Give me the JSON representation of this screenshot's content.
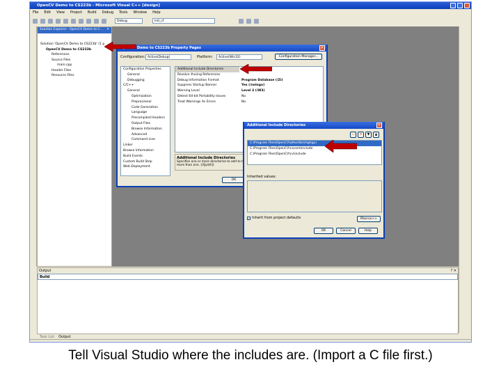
{
  "window": {
    "title": "OpenCV Demo to CS223b - Microsoft Visual C++ [design]"
  },
  "menu": [
    "File",
    "Edit",
    "View",
    "Project",
    "Build",
    "Debug",
    "Tools",
    "Window",
    "Help"
  ],
  "toolbar": {
    "config_combo": "Debug",
    "find_combo": "init_cf"
  },
  "solution_explorer": {
    "title": "Solution Explorer - OpenCV Demo to C...",
    "items": [
      "Solution 'OpenCV Demo to CS223b' (1 p",
      "OpenCV Demo to CS223b",
      "References",
      "Source Files",
      "main.cpp",
      "Header Files",
      "Resource Files"
    ]
  },
  "property_pages": {
    "title": "OpenCV Demo to CS223b Property Pages",
    "configuration_label": "Configuration:",
    "configuration_value": "Active(Debug)",
    "platform_label": "Platform:",
    "platform_value": "Active(Win32)",
    "config_manager": "Configuration Manager...",
    "tree": [
      "Configuration Properties",
      "General",
      "Debugging",
      "C/C++",
      "General",
      "Optimization",
      "Preprocessor",
      "Code Generation",
      "Language",
      "Precompiled Headers",
      "Output Files",
      "Browse Information",
      "Advanced",
      "Command Line",
      "Linker",
      "Browse Information",
      "Build Events",
      "Custom Build Step",
      "Web Deployment"
    ],
    "properties": [
      {
        "name": "Additional Include Directories",
        "value": ""
      },
      {
        "name": "Resolve #using References",
        "value": ""
      },
      {
        "name": "Debug Information Format",
        "value": "Program Database (/Zi)"
      },
      {
        "name": "Suppress Startup Banner",
        "value": "Yes (/nologo)"
      },
      {
        "name": "Warning Level",
        "value": "Level 3 (/W3)"
      },
      {
        "name": "Detect 64-bit Portability Issues",
        "value": "No"
      },
      {
        "name": "Treat Warnings As Errors",
        "value": "No"
      }
    ],
    "desc_title": "Additional Include Directories",
    "desc_text": "Specifies one or more directories to add to the include path; use semi-colon delimited list if more than one.    (/I[path])",
    "ok": "OK"
  },
  "include_dialog": {
    "title": "Additional Include Directories",
    "paths": [
      "C:\\Program Files\\OpenCV\\otherlibs\\highgui",
      "C:\\Program Files\\OpenCV\\cxcore\\include",
      "C:\\Program Files\\OpenCV\\cv\\include"
    ],
    "inherited_label": "Inherited values:",
    "inherit_checkbox": "Inherit from project defaults",
    "inherit_checked": true,
    "macros": "Macros>>",
    "ok": "OK",
    "cancel": "Cancel",
    "help": "Help"
  },
  "output": {
    "title": "Output",
    "combo": "Build",
    "tabs": [
      "Task List",
      "Output"
    ]
  },
  "caption": "Tell Visual Studio where the includes are.  (Import a C file first.)",
  "colors": {
    "arrow": "#c00000",
    "titlebar": "#0a3fb8",
    "mdi": "#808080"
  }
}
